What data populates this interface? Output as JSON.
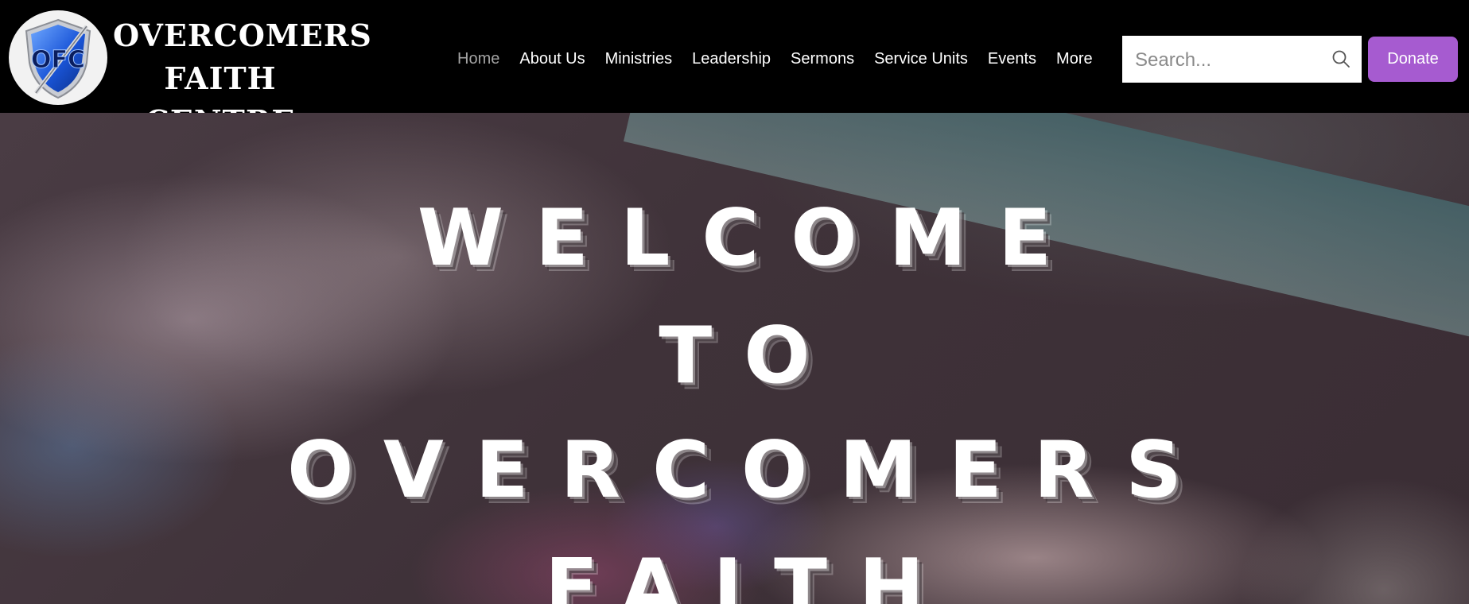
{
  "brand": {
    "logo_text": "OFC",
    "name_line1": "OVERCOMERS",
    "name_line2": "FAITH CENTRE"
  },
  "nav": {
    "items": [
      {
        "label": "Home",
        "active": true
      },
      {
        "label": "About Us",
        "active": false
      },
      {
        "label": "Ministries",
        "active": false
      },
      {
        "label": "Leadership",
        "active": false
      },
      {
        "label": "Sermons",
        "active": false
      },
      {
        "label": "Service Units",
        "active": false
      },
      {
        "label": "Events",
        "active": false
      },
      {
        "label": "More",
        "active": false
      }
    ]
  },
  "search": {
    "placeholder": "Search...",
    "icon": "search-icon"
  },
  "donate": {
    "label": "Donate",
    "color": "#a65bd0"
  },
  "hero": {
    "lines": [
      "WELCOME",
      "TO",
      "OVERCOMERS",
      "FAITH"
    ]
  },
  "colors": {
    "header_bg": "#000000",
    "nav_text": "#ffffff",
    "nav_active": "#a3a3a3"
  }
}
